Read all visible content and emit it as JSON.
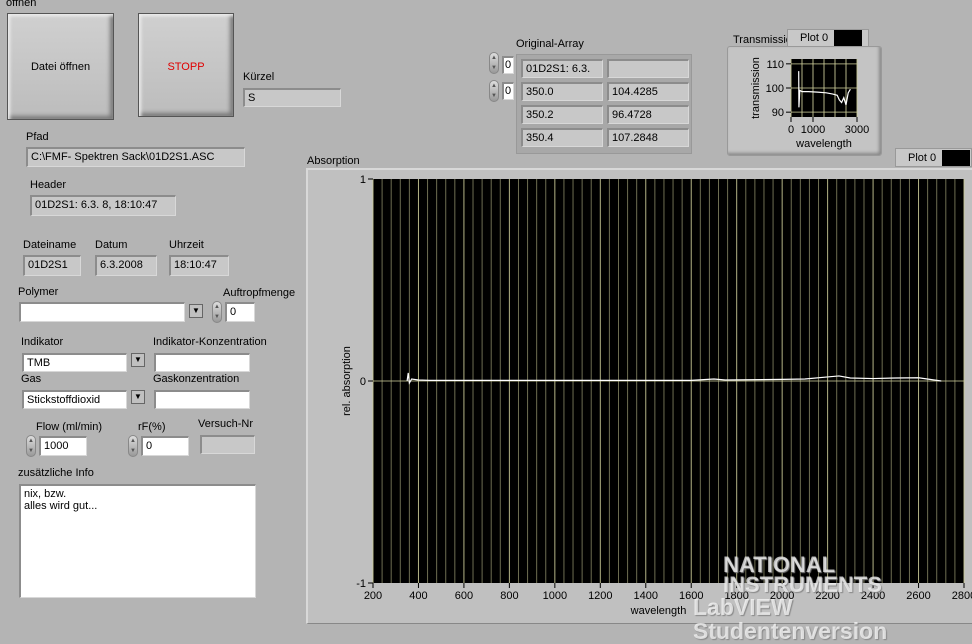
{
  "top_label": "öffnen",
  "buttons": {
    "open": "Datei öffnen",
    "stop": "STOPP"
  },
  "kuerzel": {
    "label": "Kürzel",
    "value": "S"
  },
  "pfad": {
    "label": "Pfad",
    "value": "C:\\FMF- Spektren Sack\\01D2S1.ASC"
  },
  "header": {
    "label": "Header",
    "value": "01D2S1: 6.3. 8, 18:10:47"
  },
  "dateiname": {
    "label": "Dateiname",
    "value": "01D2S1"
  },
  "datum": {
    "label": "Datum",
    "value": "6.3.2008"
  },
  "uhrzeit": {
    "label": "Uhrzeit",
    "value": "18:10:47"
  },
  "polymer": {
    "label": "Polymer",
    "value": ""
  },
  "auftropfmenge": {
    "label": "Auftropfmenge",
    "value": "0"
  },
  "indikator": {
    "label": "Indikator",
    "value": "TMB"
  },
  "indikator_konz": {
    "label": "Indikator-Konzentration",
    "value": ""
  },
  "gas": {
    "label": "Gas",
    "value": "Stickstoffdioxid"
  },
  "gaskonz": {
    "label": "Gaskonzentration",
    "value": ""
  },
  "flow": {
    "label": "Flow (ml/min)",
    "value": "1000"
  },
  "rf": {
    "label": "rF(%)",
    "value": "0"
  },
  "versuch": {
    "label": "Versuch-Nr",
    "value": ""
  },
  "info": {
    "label": "zusätzliche Info",
    "value": "nix, bzw.\nalles wird gut..."
  },
  "array": {
    "label": "Original-Array",
    "index0": "0",
    "index1": "0",
    "rows": [
      [
        "01D2S1: 6.3.",
        ""
      ],
      [
        "350.0",
        "104.4285"
      ],
      [
        "350.2",
        "96.4728"
      ],
      [
        "350.4",
        "107.2848"
      ]
    ]
  },
  "chart_data": [
    {
      "type": "line",
      "title": "Transmission 2",
      "legend": "Plot 0",
      "xlabel": "wavelength",
      "ylabel": "transmission",
      "xlim": [
        0,
        3000
      ],
      "ylim": [
        88,
        112
      ],
      "xticks": [
        "0",
        "1000",
        "3000"
      ],
      "yticks": [
        "90",
        "100",
        "110"
      ],
      "x": [
        350,
        360,
        400,
        500,
        800,
        1200,
        1600,
        1900,
        2100,
        2200,
        2300,
        2400,
        2500,
        2600,
        2700
      ],
      "y": [
        107,
        92,
        99,
        98.5,
        98.5,
        98.3,
        98,
        97.5,
        97,
        95,
        94,
        96,
        93,
        98,
        99.5
      ],
      "grid": true
    },
    {
      "type": "line",
      "title": "Absorption",
      "legend": "Plot 0",
      "xlabel": "wavelength",
      "ylabel": "rel. absorption",
      "xlim": [
        200,
        2800
      ],
      "ylim": [
        -1,
        1
      ],
      "xticks": [
        "200",
        "400",
        "600",
        "800",
        "1000",
        "1200",
        "1400",
        "1600",
        "1800",
        "2000",
        "2200",
        "2400",
        "2600",
        "2800"
      ],
      "yticks": [
        "1",
        "0",
        "-1"
      ],
      "x": [
        350,
        355,
        360,
        370,
        400,
        450,
        1600,
        1700,
        1750,
        2000,
        2100,
        2200,
        2250,
        2300,
        2400,
        2500,
        2600,
        2700
      ],
      "y": [
        0,
        0.04,
        -0.01,
        0.01,
        0.005,
        0.003,
        0.003,
        0.01,
        0.005,
        0.008,
        0.01,
        0.02,
        0.025,
        0.015,
        0.012,
        0.015,
        0.016,
        0
      ],
      "grid": true
    }
  ],
  "watermark": {
    "line1": "NATIONAL",
    "line2": "INSTRUMENTS",
    "line3": "LabVIEW Studentenversion"
  },
  "colors": {
    "panel": "#b4b4b4",
    "plot_bg": "#000000",
    "grid": "#c8c896",
    "trace": "#ffffff",
    "stop_text": "#e00000"
  }
}
